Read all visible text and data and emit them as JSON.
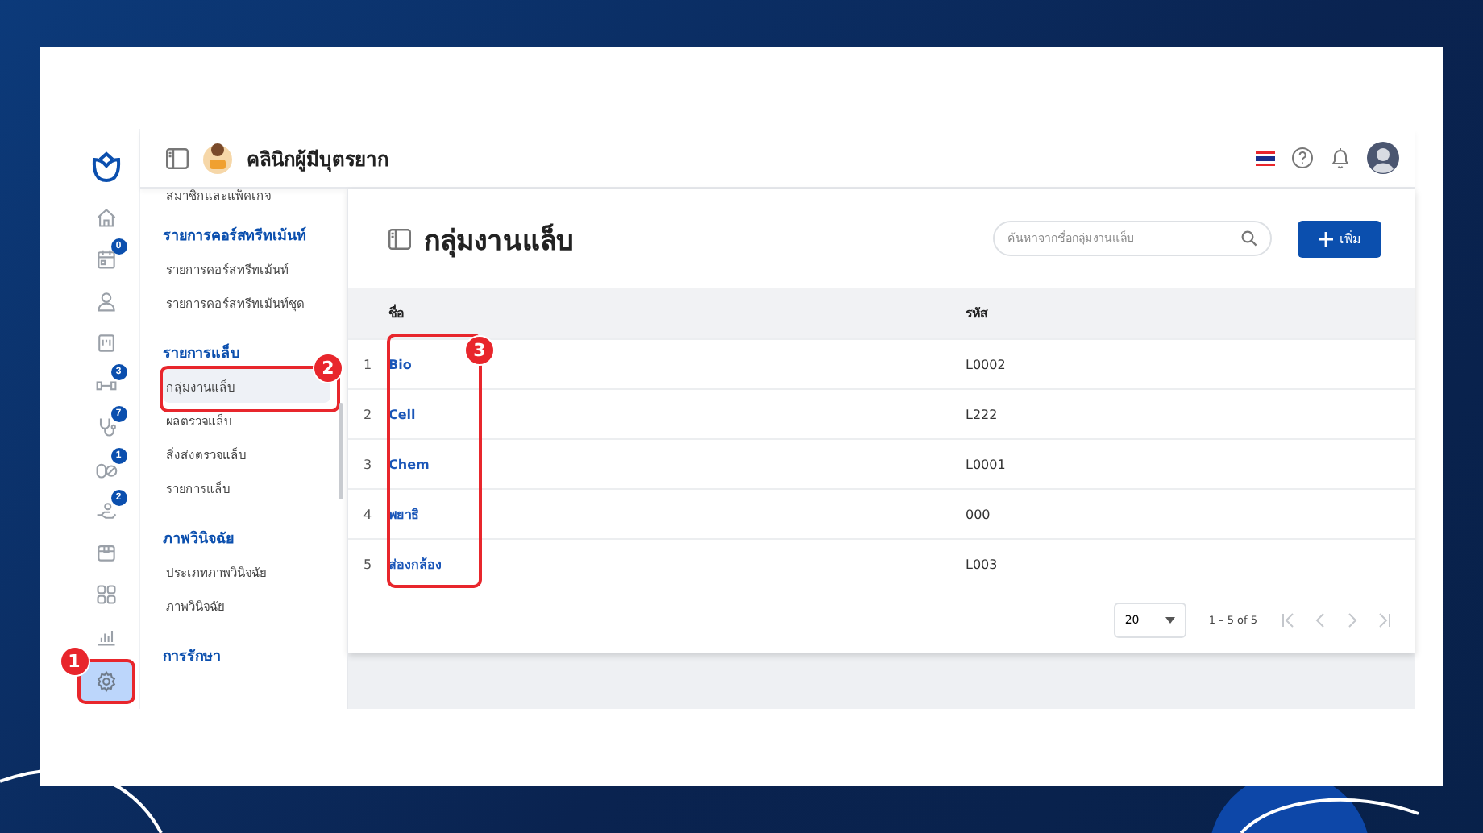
{
  "header": {
    "clinic_name": "คลินิกผู้มีบุตรยาก"
  },
  "rail": [
    {
      "selected": false
    },
    {
      "badge": "0",
      "selected": false
    },
    {
      "selected": false
    },
    {
      "selected": false
    },
    {
      "badge": "3",
      "selected": false
    },
    {
      "badge": "7",
      "selected": false
    },
    {
      "badge": "1",
      "selected": false
    },
    {
      "badge": "2",
      "selected": false
    },
    {
      "selected": false
    },
    {
      "selected": false
    },
    {
      "selected": false
    },
    {
      "selected": true,
      "callout": "1"
    }
  ],
  "sidebar": [
    {
      "kind": "item",
      "label": "สมาชิกและแพ็คเกจ",
      "selected": false
    },
    {
      "kind": "heading",
      "label": "รายการคอร์สทรีทเม้นท์"
    },
    {
      "kind": "item",
      "label": "รายการคอร์สทรีทเม้นท์",
      "selected": false
    },
    {
      "kind": "item",
      "label": "รายการคอร์สทรีทเม้นท์ชุด",
      "selected": false
    },
    {
      "kind": "heading",
      "label": "รายการแล็บ"
    },
    {
      "kind": "item",
      "label": "กลุ่มงานแล็บ",
      "selected": true,
      "callout": "2"
    },
    {
      "kind": "item",
      "label": "ผลตรวจแล็บ",
      "selected": false
    },
    {
      "kind": "item",
      "label": "สิ่งส่งตรวจแล็บ",
      "selected": false
    },
    {
      "kind": "item",
      "label": "รายการแล็บ",
      "selected": false
    },
    {
      "kind": "heading",
      "label": "ภาพวินิจฉัย"
    },
    {
      "kind": "item",
      "label": "ประเภทภาพวินิจฉัย",
      "selected": false
    },
    {
      "kind": "item",
      "label": "ภาพวินิจฉัย",
      "selected": false
    },
    {
      "kind": "heading",
      "label": "การรักษา"
    }
  ],
  "page": {
    "title": "กลุ่มงานแล็บ",
    "search": {
      "placeholder": "ค้นหาจากชื่อกลุ่มงานแล็บ"
    },
    "add_button": "เพิ่ม"
  },
  "table": {
    "columns": [
      "ชื่อ",
      "รหัส"
    ],
    "name_column_callout": "3",
    "rows": [
      {
        "index": "1",
        "name": "Bio",
        "code": "L0002"
      },
      {
        "index": "2",
        "name": "Cell",
        "code": "L222"
      },
      {
        "index": "3",
        "name": "Chem",
        "code": "L0001"
      },
      {
        "index": "4",
        "name": "พยาธิ",
        "code": "000"
      },
      {
        "index": "5",
        "name": "ส่องกล้อง",
        "code": "L003"
      }
    ]
  },
  "pagination": {
    "page_size": "20",
    "range": "1 – 5 of 5"
  }
}
